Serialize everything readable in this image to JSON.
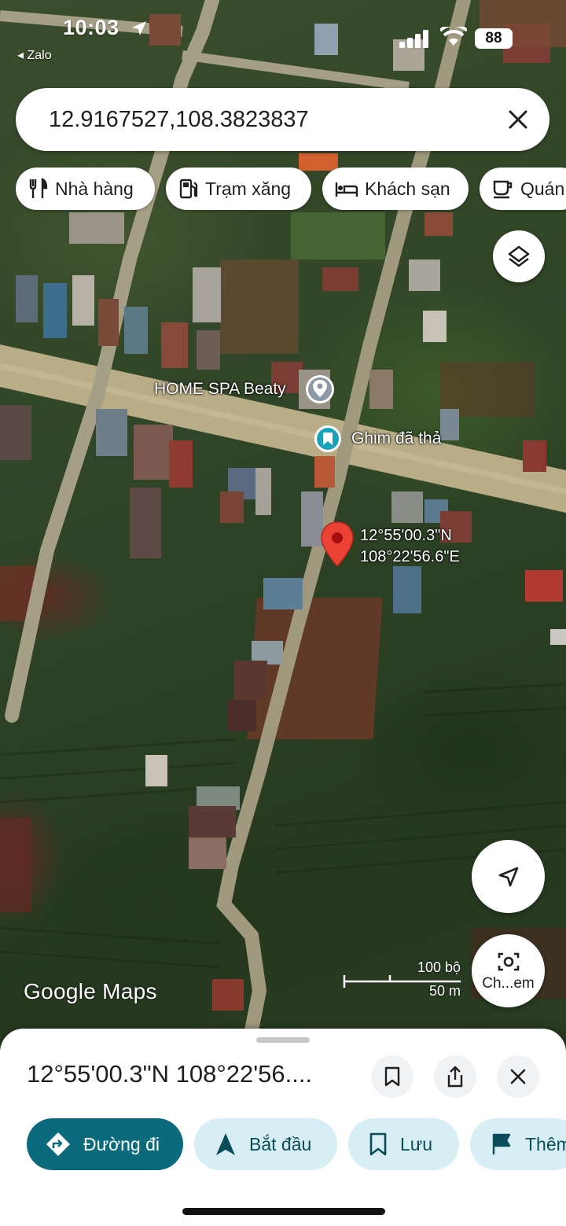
{
  "status_bar": {
    "time": "10:03",
    "back_app": "◂ Zalo",
    "battery": "88"
  },
  "search": {
    "value": "12.9167527,108.3823837"
  },
  "chips": [
    {
      "label": "Nhà hàng",
      "icon": "restaurant-icon"
    },
    {
      "label": "Trạm xăng",
      "icon": "gas-station-icon"
    },
    {
      "label": "Khách sạn",
      "icon": "hotel-icon"
    },
    {
      "label": "Quán",
      "icon": "coffee-icon"
    }
  ],
  "map": {
    "place_label": "HOME SPA Beaty",
    "dropped_pin_label": "Ghim đã thả",
    "pin_coords_lat": "12°55'00.3\"N",
    "pin_coords_lng": "108°22'56.6\"E",
    "scale_feet": "100 bộ",
    "scale_meters": "50 m",
    "logo": "Google Maps",
    "lens_label": "Ch...em"
  },
  "sheet": {
    "title": "12°55'00.3\"N 108°22'56....",
    "actions": [
      {
        "label": "Đường đi",
        "icon": "directions-icon"
      },
      {
        "label": "Bắt đầu",
        "icon": "navigation-arrow-icon"
      },
      {
        "label": "Lưu",
        "icon": "bookmark-icon"
      },
      {
        "label": "Thêm",
        "icon": "flag-icon"
      }
    ]
  },
  "colors": {
    "primary_action": "#0b6b7c",
    "secondary_action": "#d7eef5",
    "pin_red": "#ea4335",
    "dropped_pin_teal": "#1aa3b8"
  }
}
